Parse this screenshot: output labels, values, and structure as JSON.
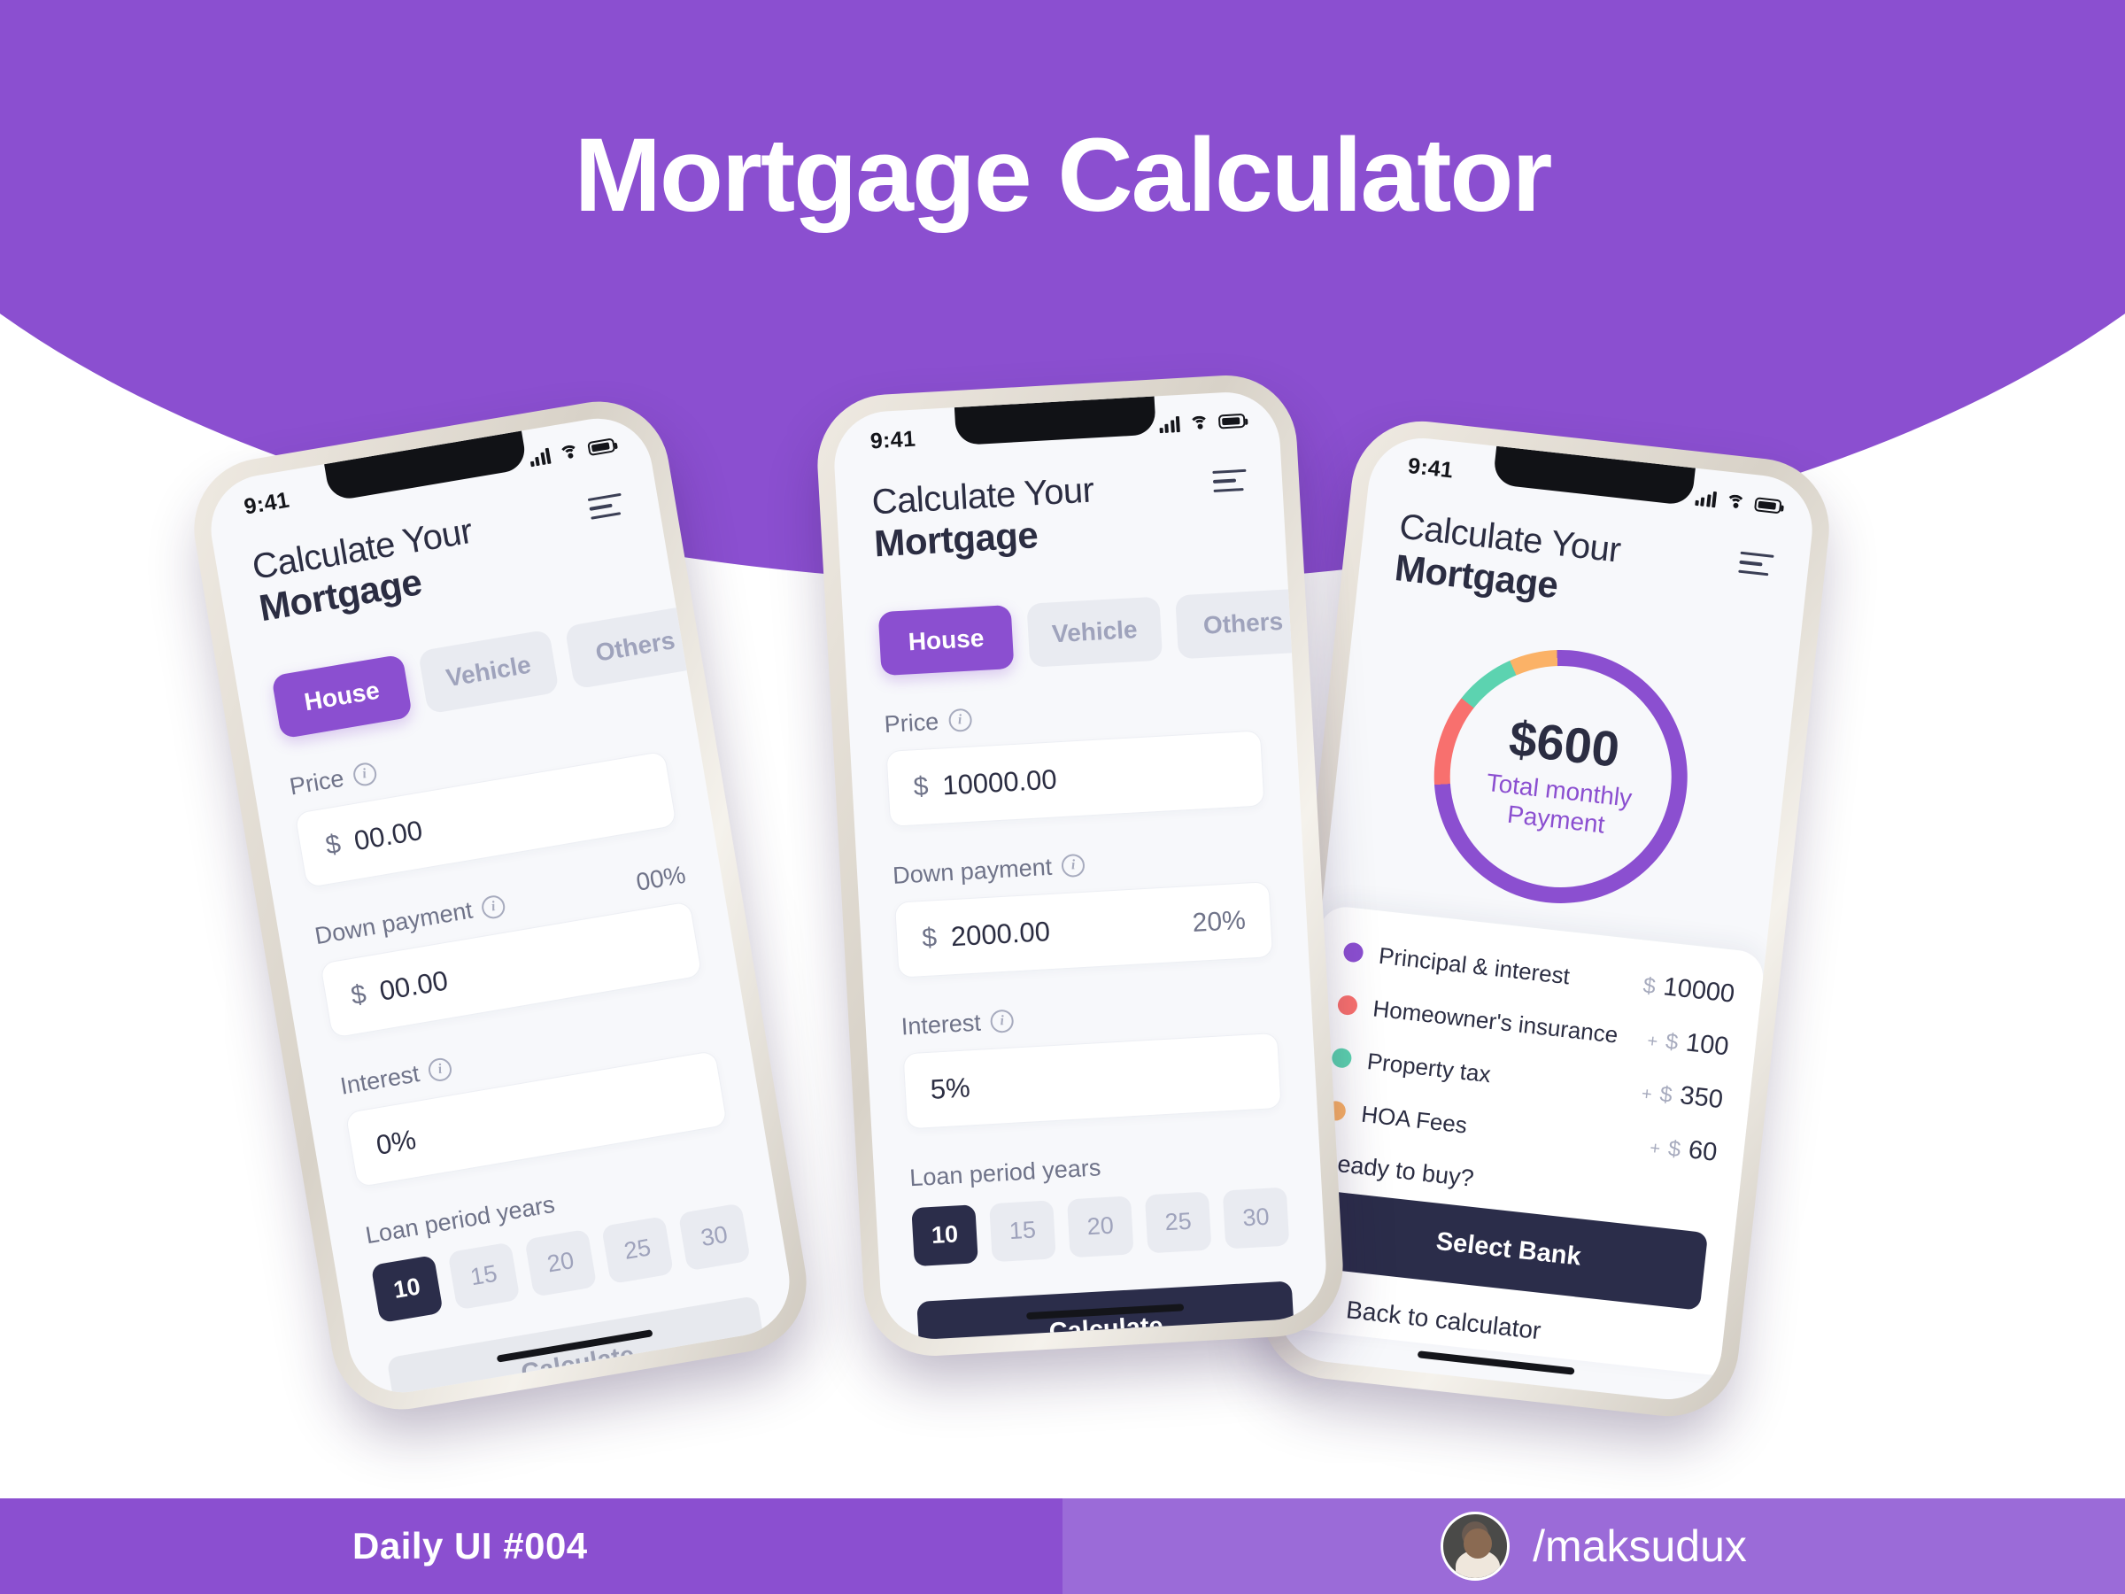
{
  "hero": {
    "title": "Mortgage Calculator",
    "bg": "#8B4FD0"
  },
  "footer": {
    "left_label": "Daily UI  #004",
    "handle": "/maksudux",
    "left_bg": "#8B4FD0",
    "right_bg": "#9B6BD8"
  },
  "status_bar": {
    "time": "9:41",
    "signal": "signal-bars-icon",
    "wifi": "wifi-icon",
    "battery": "battery-icon"
  },
  "app": {
    "title_line1": "Calculate Your",
    "title_line2": "Mortgage",
    "menu_icon": "hamburger-menu-icon"
  },
  "tabs": [
    {
      "label": "House",
      "active": true
    },
    {
      "label": "Vehicle",
      "active": false
    },
    {
      "label": "Others",
      "active": false
    }
  ],
  "loan_period": {
    "label": "Loan period years",
    "options": [
      "10",
      "15",
      "20",
      "25",
      "30"
    ],
    "selected": "10"
  },
  "screen_empty": {
    "price": {
      "label": "Price",
      "currency": "$",
      "value": "00.00"
    },
    "down_payment": {
      "label": "Down payment",
      "currency": "$",
      "value": "00.00",
      "percent": "00%"
    },
    "interest": {
      "label": "Interest",
      "value": "0%"
    },
    "calculate_label": "Calculate"
  },
  "screen_filled": {
    "price": {
      "label": "Price",
      "currency": "$",
      "value": "10000.00"
    },
    "down_payment": {
      "label": "Down payment",
      "currency": "$",
      "value": "2000.00",
      "percent": "20%"
    },
    "interest": {
      "label": "Interest",
      "value": "5%"
    },
    "calculate_label": "Calculate"
  },
  "screen_result": {
    "total": {
      "amount": "$600",
      "caption_line1": "Total monthly",
      "caption_line2": "Payment"
    },
    "breakdown": [
      {
        "name": "Principal & interest",
        "color": "#8B4FD0",
        "plus": "",
        "currency": "$",
        "value": "10000"
      },
      {
        "name": "Homeowner's insurance",
        "color": "#F8706E",
        "plus": "+",
        "currency": "$",
        "value": "100"
      },
      {
        "name": "Property tax",
        "color": "#5CD3B0",
        "plus": "+",
        "currency": "$",
        "value": "350"
      },
      {
        "name": "HOA Fees",
        "color": "#FBB267",
        "plus": "+",
        "currency": "$",
        "value": "60"
      }
    ],
    "ready_label": "Ready to buy?",
    "select_bank_label": "Select Bank",
    "back_label": "Back to calculator",
    "back_icon": "chevron-left-icon"
  },
  "chart_data": {
    "type": "pie",
    "title": "Total monthly Payment",
    "labels": [
      "Principal & interest",
      "Homeowner's insurance",
      "Property tax",
      "HOA Fees"
    ],
    "values": [
      10000,
      100,
      350,
      60
    ],
    "colors": [
      "#8B4FD0",
      "#F8706E",
      "#5CD3B0",
      "#FBB267"
    ],
    "display_arc_degrees": [
      268,
      42,
      28,
      22
    ],
    "center_value": "$600",
    "legend": "right-of-chart-list"
  }
}
